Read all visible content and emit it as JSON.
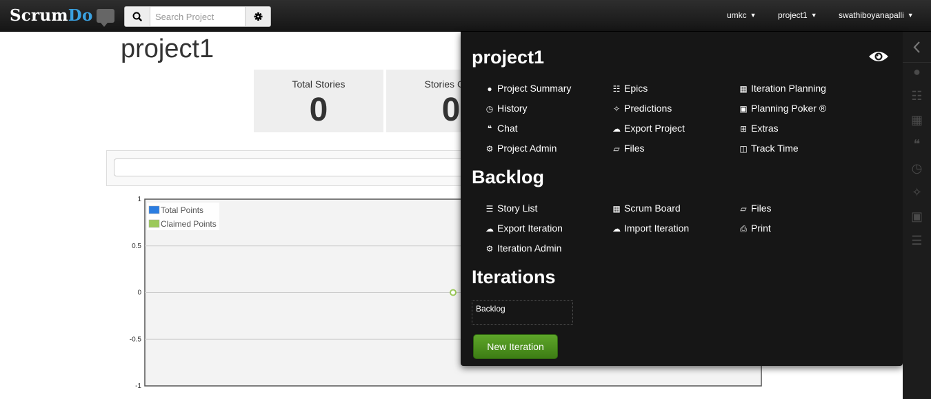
{
  "header": {
    "logo_scrum": "Scrum",
    "logo_do": "Do",
    "search_placeholder": "Search Project",
    "nav": [
      "umkc",
      "project1",
      "swathiboyanapalli"
    ]
  },
  "page": {
    "title": "project1",
    "stats": [
      {
        "label": "Total Stories",
        "value": "0"
      },
      {
        "label": "Stories Com",
        "value": "0"
      }
    ]
  },
  "chart_data": {
    "type": "line",
    "series": [
      {
        "name": "Total Points",
        "color": "#2a7de1"
      },
      {
        "name": "Claimed Points",
        "color": "#9bc95a",
        "points": [
          [
            0.5,
            0
          ]
        ]
      }
    ],
    "yticks": [
      "1",
      "0.5",
      "0",
      "-0.5",
      "-1"
    ],
    "ylim": [
      -1,
      1
    ],
    "grid": true,
    "legend_position": "top-left"
  },
  "overlay": {
    "project_title": "project1",
    "project_links": [
      {
        "icon": "globe-icon",
        "label": "Project Summary"
      },
      {
        "icon": "sitemap-icon",
        "label": "Epics"
      },
      {
        "icon": "calendar-icon",
        "label": "Iteration Planning"
      },
      {
        "icon": "clock-icon",
        "label": "History"
      },
      {
        "icon": "magic-wand-icon",
        "label": "Predictions"
      },
      {
        "icon": "grid-icon",
        "label": "Planning Poker ®"
      },
      {
        "icon": "quote-icon",
        "label": "Chat"
      },
      {
        "icon": "cloud-download-icon",
        "label": "Export Project"
      },
      {
        "icon": "plus-square-icon",
        "label": "Extras"
      },
      {
        "icon": "cogs-icon",
        "label": "Project Admin"
      },
      {
        "icon": "folder-open-icon",
        "label": "Files"
      },
      {
        "icon": "columns-icon",
        "label": "Track Time"
      }
    ],
    "backlog_title": "Backlog",
    "backlog_links": [
      {
        "icon": "list-icon",
        "label": "Story List"
      },
      {
        "icon": "board-icon",
        "label": "Scrum Board"
      },
      {
        "icon": "folder-open-icon",
        "label": "Files"
      },
      {
        "icon": "cloud-download-icon",
        "label": "Export Iteration"
      },
      {
        "icon": "cloud-upload-icon",
        "label": "Import Iteration"
      },
      {
        "icon": "print-icon",
        "label": "Print"
      },
      {
        "icon": "cogs-icon",
        "label": "Iteration Admin"
      }
    ],
    "iterations_title": "Iterations",
    "iteration_item": "Backlog",
    "new_iteration_button": "New Iteration"
  },
  "rail_icons": [
    "chevron-left-icon",
    "globe-icon",
    "sitemap-icon",
    "calendar-icon",
    "quote-icon",
    "clock-icon",
    "magic-wand-icon",
    "grid-icon",
    "list-icon"
  ]
}
